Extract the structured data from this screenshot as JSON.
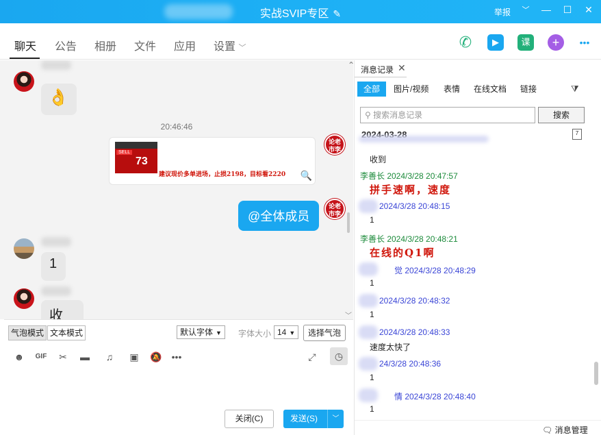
{
  "window": {
    "title": "实战SVIP专区",
    "report_label": "举报",
    "chevron": "﹀",
    "minimize": "—",
    "maximize": "☐",
    "close": "✕"
  },
  "tabs": [
    "聊天",
    "公告",
    "相册",
    "文件",
    "应用",
    "设置"
  ],
  "tab_caret": "﹀",
  "toolbar_icons": [
    {
      "name": "phone-icon",
      "glyph": "✆",
      "color": "#22b07a"
    },
    {
      "name": "video-icon",
      "glyph": "▶",
      "color": "#1aa7f0"
    },
    {
      "name": "course-icon",
      "glyph": "课",
      "color": "#22b07a"
    },
    {
      "name": "add-app-icon",
      "glyph": "+",
      "color": "#a45ee5"
    },
    {
      "name": "more-icon",
      "glyph": "•••",
      "color": "#1aa7f0"
    }
  ],
  "chat": {
    "timestamp": "20:46:46",
    "card_text": "建议现价多单进场，止损2198，目标看2220",
    "card_stock_number": "73",
    "card_stock_sell": "SELL",
    "mention_bubble": "@全体成员",
    "msg_one": "1",
    "msg_received": "收到",
    "red_avatar_text": "论老市李"
  },
  "input": {
    "bubble_mode": "气泡模式",
    "text_mode": "文本模式",
    "font_default": "默认字体",
    "font_size_label": "字体大小",
    "font_size": "14",
    "choose_bubble": "选择气泡",
    "close_button": "关闭(C)",
    "send_button": "发送(S)"
  },
  "history": {
    "tab_label": "消息记录",
    "filters": [
      "全部",
      "图片/视频",
      "表情",
      "在线文档",
      "链接"
    ],
    "search_placeholder": "搜索消息记录",
    "search_button": "搜索",
    "date": "2024-03-28",
    "manage_label": "消息管理",
    "records": [
      {
        "name": "",
        "time": "",
        "text": "收到",
        "name_color": "blue"
      },
      {
        "name": "李善长",
        "time": "2024/3/28 20:47:57",
        "text": "拼手速啊，速度",
        "name_color": "green",
        "styled": true
      },
      {
        "name": "",
        "time": "2024/3/28 20:48:15",
        "text": "1",
        "name_color": "blue"
      },
      {
        "name": "李善长",
        "time": "2024/3/28 20:48:21",
        "text": "在线的Q1啊",
        "name_color": "green",
        "styled": true
      },
      {
        "name": "觉",
        "time": "2024/3/28 20:48:29",
        "text": "1",
        "name_color": "blue"
      },
      {
        "name": "",
        "time": "2024/3/28 20:48:32",
        "text": "1",
        "name_color": "blue"
      },
      {
        "name": "",
        "time": "2024/3/28 20:48:33",
        "text": "速度太快了",
        "name_color": "blue"
      },
      {
        "name": "",
        "time": "24/3/28 20:48:36",
        "text": "1",
        "name_color": "blue"
      },
      {
        "name": "情",
        "time": "2024/3/28 20:48:40",
        "text": "1",
        "name_color": "blue"
      }
    ]
  }
}
